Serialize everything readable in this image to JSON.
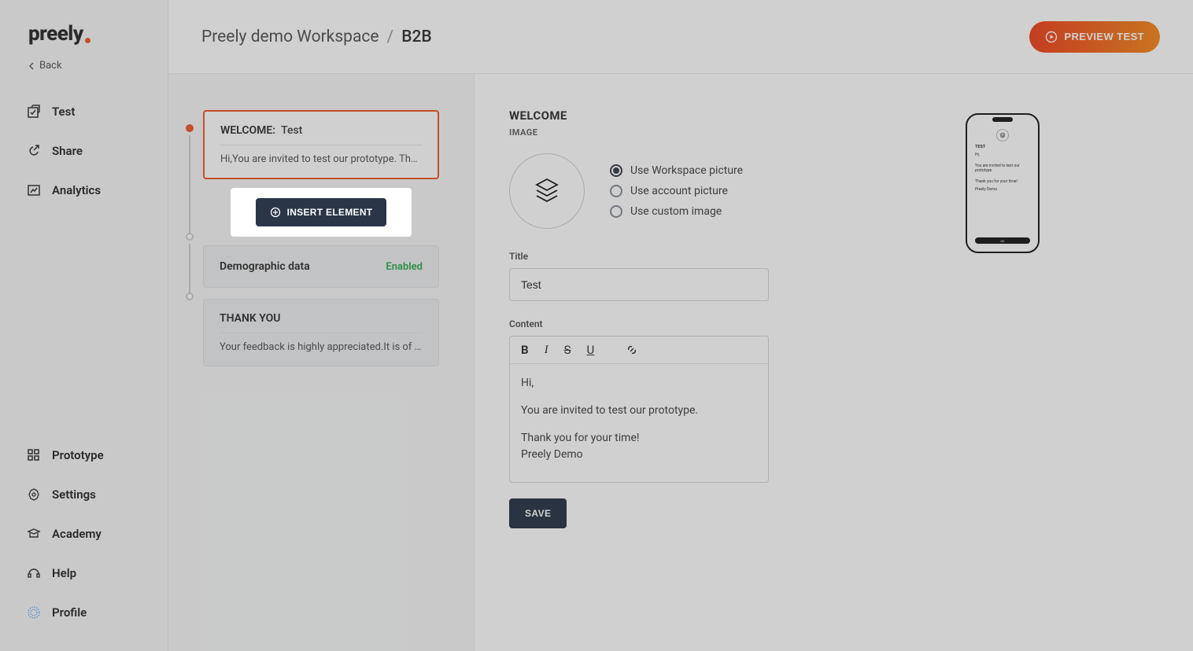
{
  "logo": "preely",
  "back_label": "Back",
  "nav_top": {
    "test": "Test",
    "share": "Share",
    "analytics": "Analytics"
  },
  "nav_bottom": {
    "prototype": "Prototype",
    "settings": "Settings",
    "academy": "Academy",
    "help": "Help",
    "profile": "Profile"
  },
  "breadcrumb": {
    "workspace": "Preely demo Workspace",
    "sep": "/",
    "project": "B2B"
  },
  "preview_label": "PREVIEW TEST",
  "steps": {
    "welcome": {
      "title_label": "WELCOME:",
      "title_value": "Test",
      "summary": "Hi,You are invited to test our prototype. Thank …"
    },
    "insert_label": "INSERT ELEMENT",
    "demo": {
      "title": "Demographic data",
      "status": "Enabled"
    },
    "thanks": {
      "title": "THANK YOU",
      "summary": "Your feedback is highly appreciated.It is of gre…"
    }
  },
  "detail": {
    "heading": "WELCOME",
    "subheading": "IMAGE",
    "radios": {
      "workspace": "Use Workspace picture",
      "account": "Use account picture",
      "custom": "Use custom image"
    },
    "title_label": "Title",
    "title_value": "Test",
    "content_label": "Content",
    "content": {
      "line1": "Hi,",
      "line2": "You are invited to test our prototype.",
      "line3": "Thank you for your time!",
      "line4": "Preely Demo"
    },
    "save_label": "SAVE"
  },
  "phone": {
    "title": "TEST",
    "l1": "Hi,",
    "l2": "You are invited to test our prototype.",
    "l3": "Thank you for your time!",
    "l4": "Preely Demo",
    "cta": "OK"
  }
}
